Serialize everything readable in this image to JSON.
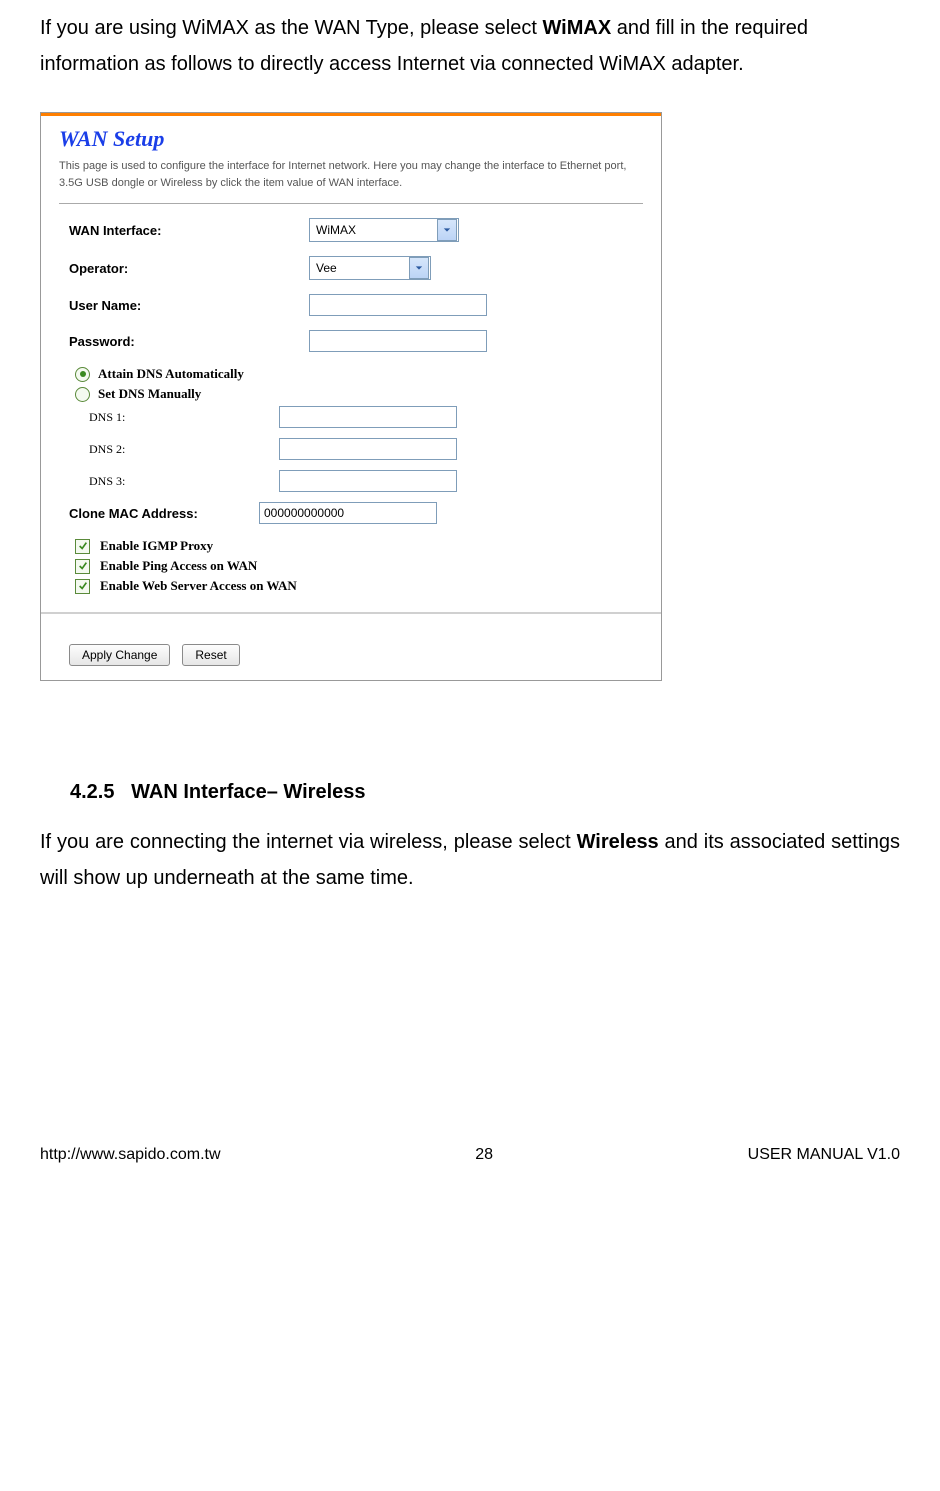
{
  "intro": {
    "pre": "If you are using WiMAX as the WAN Type, please select ",
    "bold": "WiMAX",
    "post": " and fill in the required information as follows to directly access Internet via connected WiMAX adapter."
  },
  "wan": {
    "title": "WAN Setup",
    "desc": "This page is used to configure the interface for Internet network. Here you may change the interface to Ethernet port, 3.5G USB dongle or Wireless by click the item value of WAN interface.",
    "labels": {
      "wan_interface": "WAN Interface:",
      "operator": "Operator:",
      "user_name": "User Name:",
      "password": "Password:",
      "dns_auto": "Attain DNS Automatically",
      "dns_manual": "Set DNS Manually",
      "dns1": "DNS 1:",
      "dns2": "DNS 2:",
      "dns3": "DNS 3:",
      "clone_mac": "Clone MAC Address:",
      "igmp": "Enable IGMP Proxy",
      "ping": "Enable Ping Access on WAN",
      "web": "Enable Web Server Access on WAN"
    },
    "values": {
      "wan_interface": "WiMAX",
      "operator": "Vee",
      "user_name": "",
      "password": "",
      "dns1": "",
      "dns2": "",
      "dns3": "",
      "clone_mac": "000000000000"
    },
    "buttons": {
      "apply": "Apply Change",
      "reset": "Reset"
    }
  },
  "section": {
    "number": "4.2.5",
    "title": "WAN Interface– Wireless",
    "text_pre": "If you are connecting the internet via wireless, please select ",
    "text_bold": "Wireless",
    "text_post": " and its associated settings will show up underneath at the same time."
  },
  "footer": {
    "url": "http://www.sapido.com.tw",
    "page": "28",
    "manual": "USER MANUAL V1.0"
  }
}
